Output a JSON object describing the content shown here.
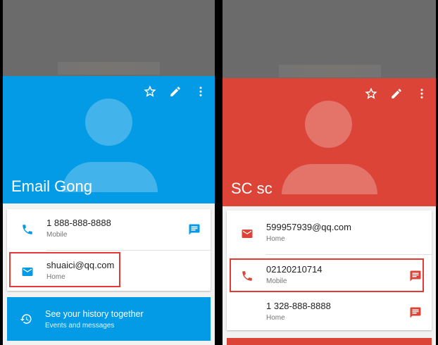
{
  "left": {
    "name": "Email Gong",
    "colors": {
      "header": "#039be5",
      "accent": "#039be5"
    },
    "rows": [
      {
        "primary": "1 888-888-8888",
        "secondary": "Mobile",
        "icon": "phone-icon",
        "action_icon": "message-icon"
      },
      {
        "primary": "shuaici@qq.com",
        "secondary": "Home",
        "icon": "email-icon"
      }
    ],
    "history": {
      "title": "See your history together",
      "subtitle": "Events and messages",
      "icon": "history-icon"
    }
  },
  "right": {
    "name": "SC sc",
    "colors": {
      "header": "#db4437",
      "accent": "#db4437"
    },
    "rows": [
      {
        "primary": "599957939@qq.com",
        "secondary": "Home",
        "icon": "email-icon"
      },
      {
        "primary": "02120210714",
        "secondary": "Mobile",
        "icon": "phone-icon",
        "action_icon": "message-icon"
      },
      {
        "primary": "1 328-888-8888",
        "secondary": "Home",
        "action_icon": "message-icon"
      }
    ]
  },
  "header_actions": [
    "star-icon",
    "edit-icon",
    "more-vert-icon"
  ],
  "highlight_color": "#e53935"
}
